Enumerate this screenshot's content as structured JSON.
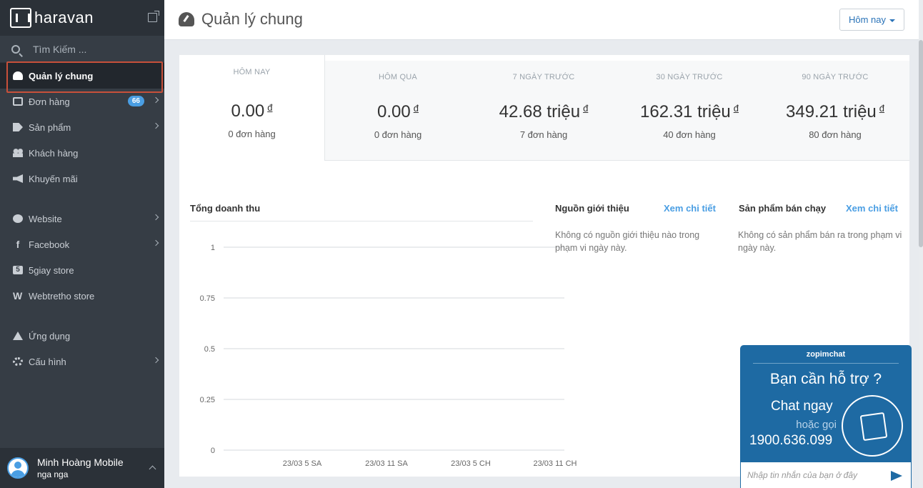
{
  "brand": {
    "name": "haravan"
  },
  "search": {
    "placeholder": "Tìm Kiếm ..."
  },
  "sidebar": {
    "items": [
      {
        "label": "Quản lý chung"
      },
      {
        "label": "Đơn hàng",
        "badge": "66"
      },
      {
        "label": "Sản phẩm"
      },
      {
        "label": "Khách hàng"
      },
      {
        "label": "Khuyến mãi"
      },
      {
        "label": "Website"
      },
      {
        "label": "Facebook"
      },
      {
        "label": "5giay store"
      },
      {
        "label": "Webtretho store"
      },
      {
        "label": "Ứng dụng"
      },
      {
        "label": "Cấu hình"
      }
    ]
  },
  "user": {
    "name": "Minh Hoàng Mobile",
    "sub": "nga nga"
  },
  "header": {
    "title": "Quản lý chung",
    "date_range": "Hôm nay"
  },
  "stats": [
    {
      "label": "HÔM NAY",
      "value": "0.00",
      "currency": "đ",
      "orders": "0 đơn hàng"
    },
    {
      "label": "HÔM QUA",
      "value": "0.00",
      "currency": "đ",
      "orders": "0 đơn hàng"
    },
    {
      "label": "7 NGÀY TRƯỚC",
      "value": "42.68 triệu",
      "currency": "đ",
      "orders": "7 đơn hàng"
    },
    {
      "label": "30 NGÀY TRƯỚC",
      "value": "162.31 triệu",
      "currency": "đ",
      "orders": "40 đơn hàng"
    },
    {
      "label": "90 NGÀY TRƯỚC",
      "value": "349.21 triệu",
      "currency": "đ",
      "orders": "80 đơn hàng"
    }
  ],
  "revenue": {
    "title": "Tổng doanh thu"
  },
  "referrals": {
    "title": "Nguồn giới thiệu",
    "link": "Xem chi tiết",
    "empty": "Không có nguồn giới thiệu nào trong phạm vi ngày này."
  },
  "bestsellers": {
    "title": "Sản phẩm bán chạy",
    "link": "Xem chi tiết",
    "empty": "Không có sản phẩm bán ra trong phạm vi ngày này."
  },
  "chart_data": {
    "type": "line",
    "title": "Tổng doanh thu",
    "categories": [
      "23/03 5 SA",
      "23/03 11 SA",
      "23/03 5 CH",
      "23/03 11 CH"
    ],
    "y_ticks": [
      "1",
      "0.75",
      "0.5",
      "0.25",
      "0"
    ],
    "ylim": [
      0,
      1
    ],
    "series": [],
    "grid": true
  },
  "chat": {
    "brand": "zopimchat",
    "question": "Bạn cần hỗ trợ ?",
    "cta": "Chat ngay",
    "or_call": "hoặc gọi",
    "phone": "1900.636.099",
    "input_placeholder": "Nhập tin nhắn của bạn ở đây"
  }
}
